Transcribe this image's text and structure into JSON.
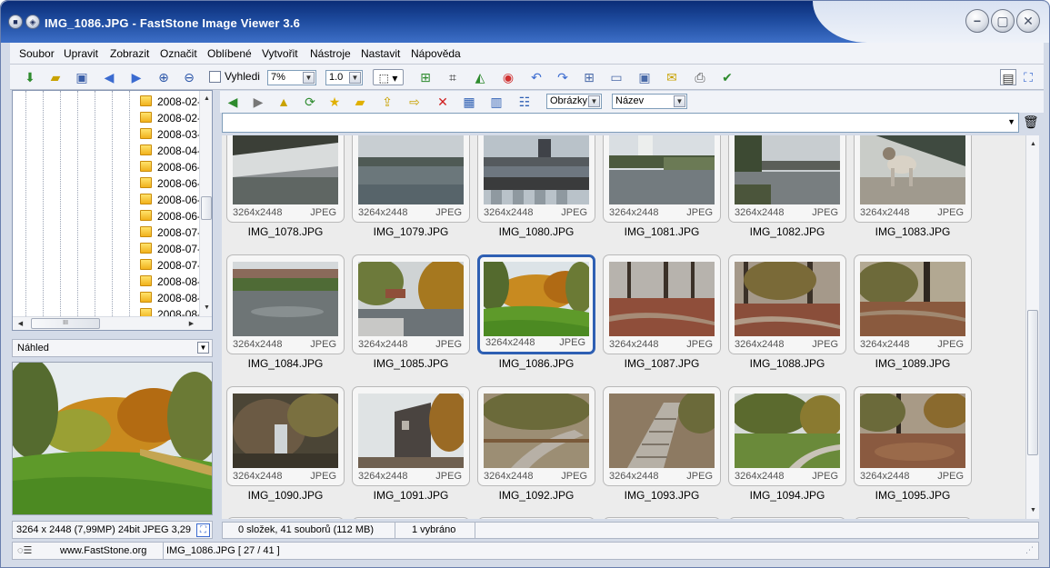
{
  "window": {
    "title": "IMG_1086.JPG  -  FastStone Image Viewer 3.6",
    "buttons": {
      "minimize": "−",
      "maximize": "▢",
      "close": "✕"
    }
  },
  "menu": [
    "Soubor",
    "Upravit",
    "Zobrazit",
    "Označit",
    "Oblíbené",
    "Vytvořit",
    "Nástroje",
    "Nastavit",
    "Nápověda"
  ],
  "toolbar": {
    "fit_label": "Vyhledi",
    "zoom_value": "7%",
    "scale_value": "1.0"
  },
  "tree": {
    "folders": [
      "2008-02-",
      "2008-02-",
      "2008-03-",
      "2008-04-",
      "2008-06-",
      "2008-06-",
      "2008-06-",
      "2008-06-",
      "2008-07-",
      "2008-07-",
      "2008-07-",
      "2008-08-",
      "2008-08-",
      "2008-08-"
    ],
    "hscroll_thumb": "III"
  },
  "preview": {
    "label": "Náhled",
    "info": "3264 x 2448 (7,99MP)   24bit JPEG   3,29"
  },
  "browser": {
    "filter_value": "Obrázky",
    "sort_value": "Název",
    "path_value": ""
  },
  "thumbnails": [
    {
      "name": "IMG_1078.JPG",
      "res": "3264x2448",
      "type": "JPEG",
      "scene": "weir"
    },
    {
      "name": "IMG_1079.JPG",
      "res": "3264x2448",
      "type": "JPEG",
      "scene": "river"
    },
    {
      "name": "IMG_1080.JPG",
      "res": "3264x2448",
      "type": "JPEG",
      "scene": "bridge"
    },
    {
      "name": "IMG_1081.JPG",
      "res": "3264x2448",
      "type": "JPEG",
      "scene": "tower"
    },
    {
      "name": "IMG_1082.JPG",
      "res": "3264x2448",
      "type": "JPEG",
      "scene": "riverbank"
    },
    {
      "name": "IMG_1083.JPG",
      "res": "3264x2448",
      "type": "JPEG",
      "scene": "dog"
    },
    {
      "name": "IMG_1084.JPG",
      "res": "3264x2448",
      "type": "JPEG",
      "scene": "canal"
    },
    {
      "name": "IMG_1085.JPG",
      "res": "3264x2448",
      "type": "JPEG",
      "scene": "autumnriver"
    },
    {
      "name": "IMG_1086.JPG",
      "res": "3264x2448",
      "type": "JPEG",
      "scene": "park",
      "selected": true
    },
    {
      "name": "IMG_1087.JPG",
      "res": "3264x2448",
      "type": "JPEG",
      "scene": "forest"
    },
    {
      "name": "IMG_1088.JPG",
      "res": "3264x2448",
      "type": "JPEG",
      "scene": "forest2"
    },
    {
      "name": "IMG_1089.JPG",
      "res": "3264x2448",
      "type": "JPEG",
      "scene": "forest3"
    },
    {
      "name": "IMG_1090.JPG",
      "res": "3264x2448",
      "type": "JPEG",
      "scene": "rocks"
    },
    {
      "name": "IMG_1091.JPG",
      "res": "3264x2448",
      "type": "JPEG",
      "scene": "house"
    },
    {
      "name": "IMG_1092.JPG",
      "res": "3264x2448",
      "type": "JPEG",
      "scene": "path"
    },
    {
      "name": "IMG_1093.JPG",
      "res": "3264x2448",
      "type": "JPEG",
      "scene": "stairs"
    },
    {
      "name": "IMG_1094.JPG",
      "res": "3264x2448",
      "type": "JPEG",
      "scene": "parkpath"
    },
    {
      "name": "IMG_1095.JPG",
      "res": "3264x2448",
      "type": "JPEG",
      "scene": "leaves"
    }
  ],
  "status": {
    "summary": "0 složek, 41 souborů (112 MB)",
    "selected": "1 vybráno",
    "website": "www.FastStone.org",
    "file_position": "IMG_1086.JPG [ 27 / 41 ]"
  }
}
